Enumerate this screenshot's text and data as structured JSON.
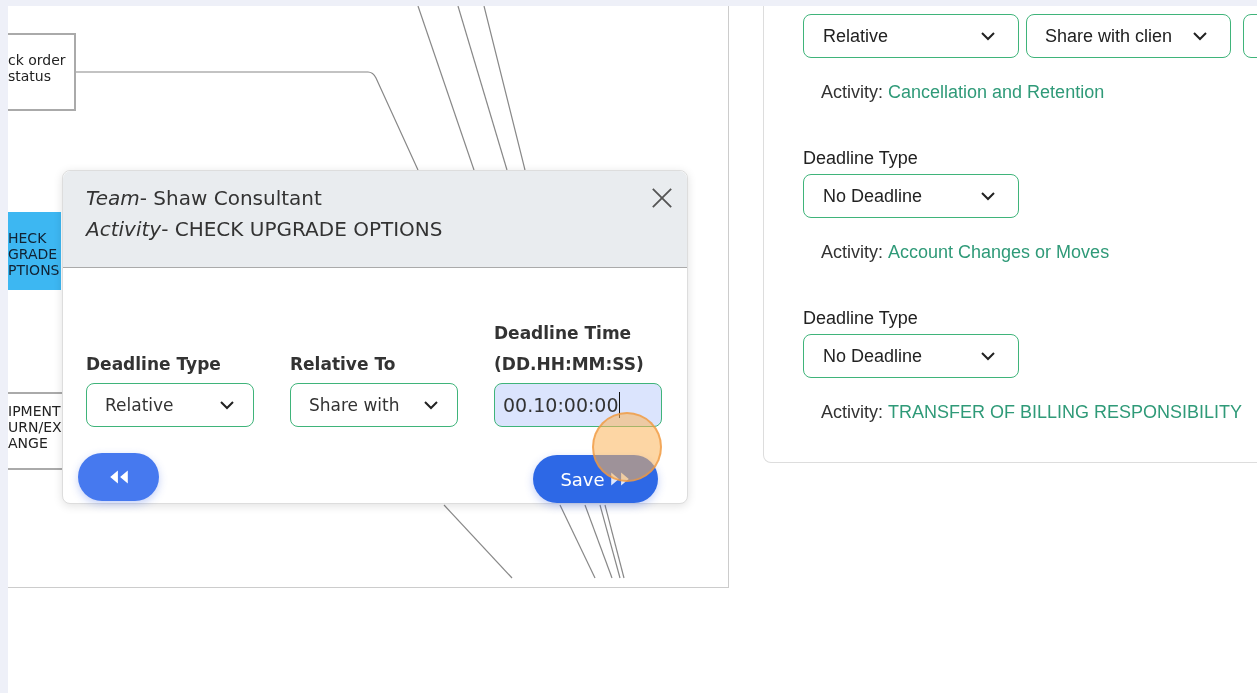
{
  "diagram": {
    "nodes": [
      {
        "kind": "plain",
        "lines": [
          "ck order",
          "status"
        ]
      },
      {
        "kind": "active",
        "lines": [
          "HECK",
          "GRADE",
          "PTIONS"
        ]
      },
      {
        "kind": "plain",
        "lines": [
          "IPMENT",
          "URN/EX",
          "ANGE"
        ]
      }
    ]
  },
  "dialog": {
    "header": [
      "*Team*- Shaw Consultant",
      "*Activity*- CHECK UPGRADE OPTIONS"
    ],
    "fields": [
      {
        "kind": "select",
        "label": "Deadline Type",
        "value": "Relative"
      },
      {
        "kind": "select",
        "label": "Relative To",
        "value": "Share with"
      },
      {
        "kind": "input",
        "label": "Deadline Time (DD.HH:MM:SS)",
        "value": "00.10:00:00",
        "focused": true
      }
    ],
    "save_button": "Save"
  },
  "activities": [
    {
      "selects": [
        "Relative",
        "Share with clien"
      ],
      "more_cut": true,
      "activity_label": "Activity:",
      "activity": "Cancellation and Retention"
    },
    {
      "label": "Deadline Type",
      "selects": [
        "No Deadline"
      ],
      "activity_label": "Activity:",
      "activity": "Account Changes or Moves"
    },
    {
      "label": "Deadline Type",
      "selects": [
        "No Deadline"
      ],
      "activity_label": "Activity:",
      "activity": "TRANSFER OF BILLING RESPONSIBILITY"
    }
  ]
}
